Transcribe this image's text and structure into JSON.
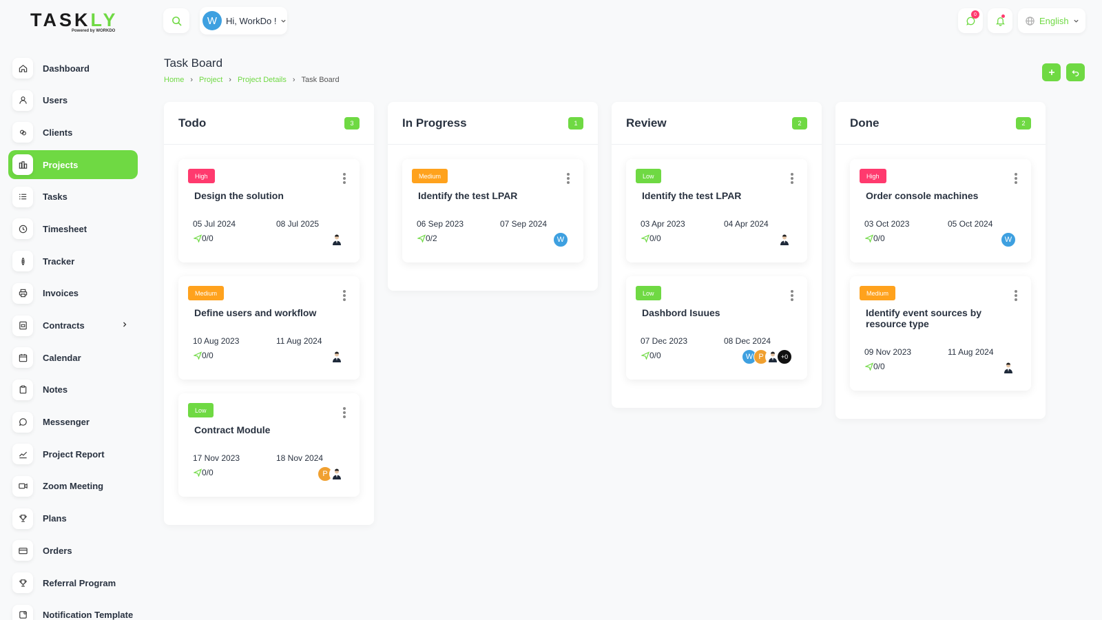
{
  "brand": {
    "name_a": "TASK",
    "name_b": "LY",
    "sub": "Powered by WORKDO"
  },
  "sidebar": {
    "items": [
      {
        "label": "Dashboard",
        "icon": "home-icon"
      },
      {
        "label": "Users",
        "icon": "user-icon"
      },
      {
        "label": "Clients",
        "icon": "clients-icon"
      },
      {
        "label": "Projects",
        "icon": "projects-icon",
        "active": true
      },
      {
        "label": "Tasks",
        "icon": "list-icon"
      },
      {
        "label": "Timesheet",
        "icon": "clock-icon"
      },
      {
        "label": "Tracker",
        "icon": "tracker-icon"
      },
      {
        "label": "Invoices",
        "icon": "printer-icon"
      },
      {
        "label": "Contracts",
        "icon": "contract-icon",
        "has_children": true
      },
      {
        "label": "Calendar",
        "icon": "calendar-icon"
      },
      {
        "label": "Notes",
        "icon": "clipboard-icon"
      },
      {
        "label": "Messenger",
        "icon": "chat-icon"
      },
      {
        "label": "Project Report",
        "icon": "chart-icon"
      },
      {
        "label": "Zoom Meeting",
        "icon": "video-icon"
      },
      {
        "label": "Plans",
        "icon": "trophy-icon"
      },
      {
        "label": "Orders",
        "icon": "card-icon"
      },
      {
        "label": "Referral Program",
        "icon": "trophy-icon"
      },
      {
        "label": "Notification Template",
        "icon": "template-icon"
      }
    ]
  },
  "header": {
    "user_initial": "W",
    "greeting": "Hi, WorkDo !",
    "message_count": "0",
    "language": "English"
  },
  "page": {
    "title": "Task Board",
    "breadcrumbs": [
      "Home",
      "Project",
      "Project Details",
      "Task Board"
    ]
  },
  "columns": [
    {
      "title": "Todo",
      "count": "3",
      "cards": [
        {
          "priority": "High",
          "title": "Design the solution",
          "start": "05 Jul 2024",
          "end": "08 Jul 2025",
          "progress": "0/0",
          "avatars": [
            "m"
          ]
        },
        {
          "priority": "Medium",
          "title": "Define users and workflow",
          "start": "10 Aug 2023",
          "end": "11 Aug 2024",
          "progress": "0/0",
          "avatars": [
            "m"
          ]
        },
        {
          "priority": "Low",
          "title": "Contract Module",
          "start": "17 Nov 2023",
          "end": "18 Nov 2024",
          "progress": "0/0",
          "avatars": [
            "P",
            "m"
          ]
        }
      ]
    },
    {
      "title": "In Progress",
      "count": "1",
      "cards": [
        {
          "priority": "Medium",
          "title": "Identify the test LPAR",
          "start": "06 Sep 2023",
          "end": "07 Sep 2024",
          "progress": "0/2",
          "avatars": [
            "W"
          ]
        }
      ]
    },
    {
      "title": "Review",
      "count": "2",
      "cards": [
        {
          "priority": "Low",
          "title": "Identify the test LPAR",
          "start": "03 Apr 2023",
          "end": "04 Apr 2024",
          "progress": "0/0",
          "avatars": [
            "m"
          ]
        },
        {
          "priority": "Low",
          "title": "Dashbord Isuues",
          "start": "07 Dec 2023",
          "end": "08 Dec 2024",
          "progress": "0/0",
          "avatars": [
            "W",
            "P",
            "m",
            "+0"
          ]
        }
      ]
    },
    {
      "title": "Done",
      "count": "2",
      "cards": [
        {
          "priority": "High",
          "title": "Order console machines",
          "start": "03 Oct 2023",
          "end": "05 Oct 2024",
          "progress": "0/0",
          "avatars": [
            "W"
          ]
        },
        {
          "priority": "Medium",
          "title": "Identify event sources by resource type",
          "start": "09 Nov 2023",
          "end": "11 Aug 2024",
          "progress": "0/0",
          "avatars": [
            "m"
          ]
        }
      ]
    }
  ],
  "colors": {
    "accent": "#6fd943",
    "high": "#ff3a6e",
    "medium": "#ffa21d",
    "low": "#6fd943",
    "avatar_w": "#3ea0e0"
  }
}
